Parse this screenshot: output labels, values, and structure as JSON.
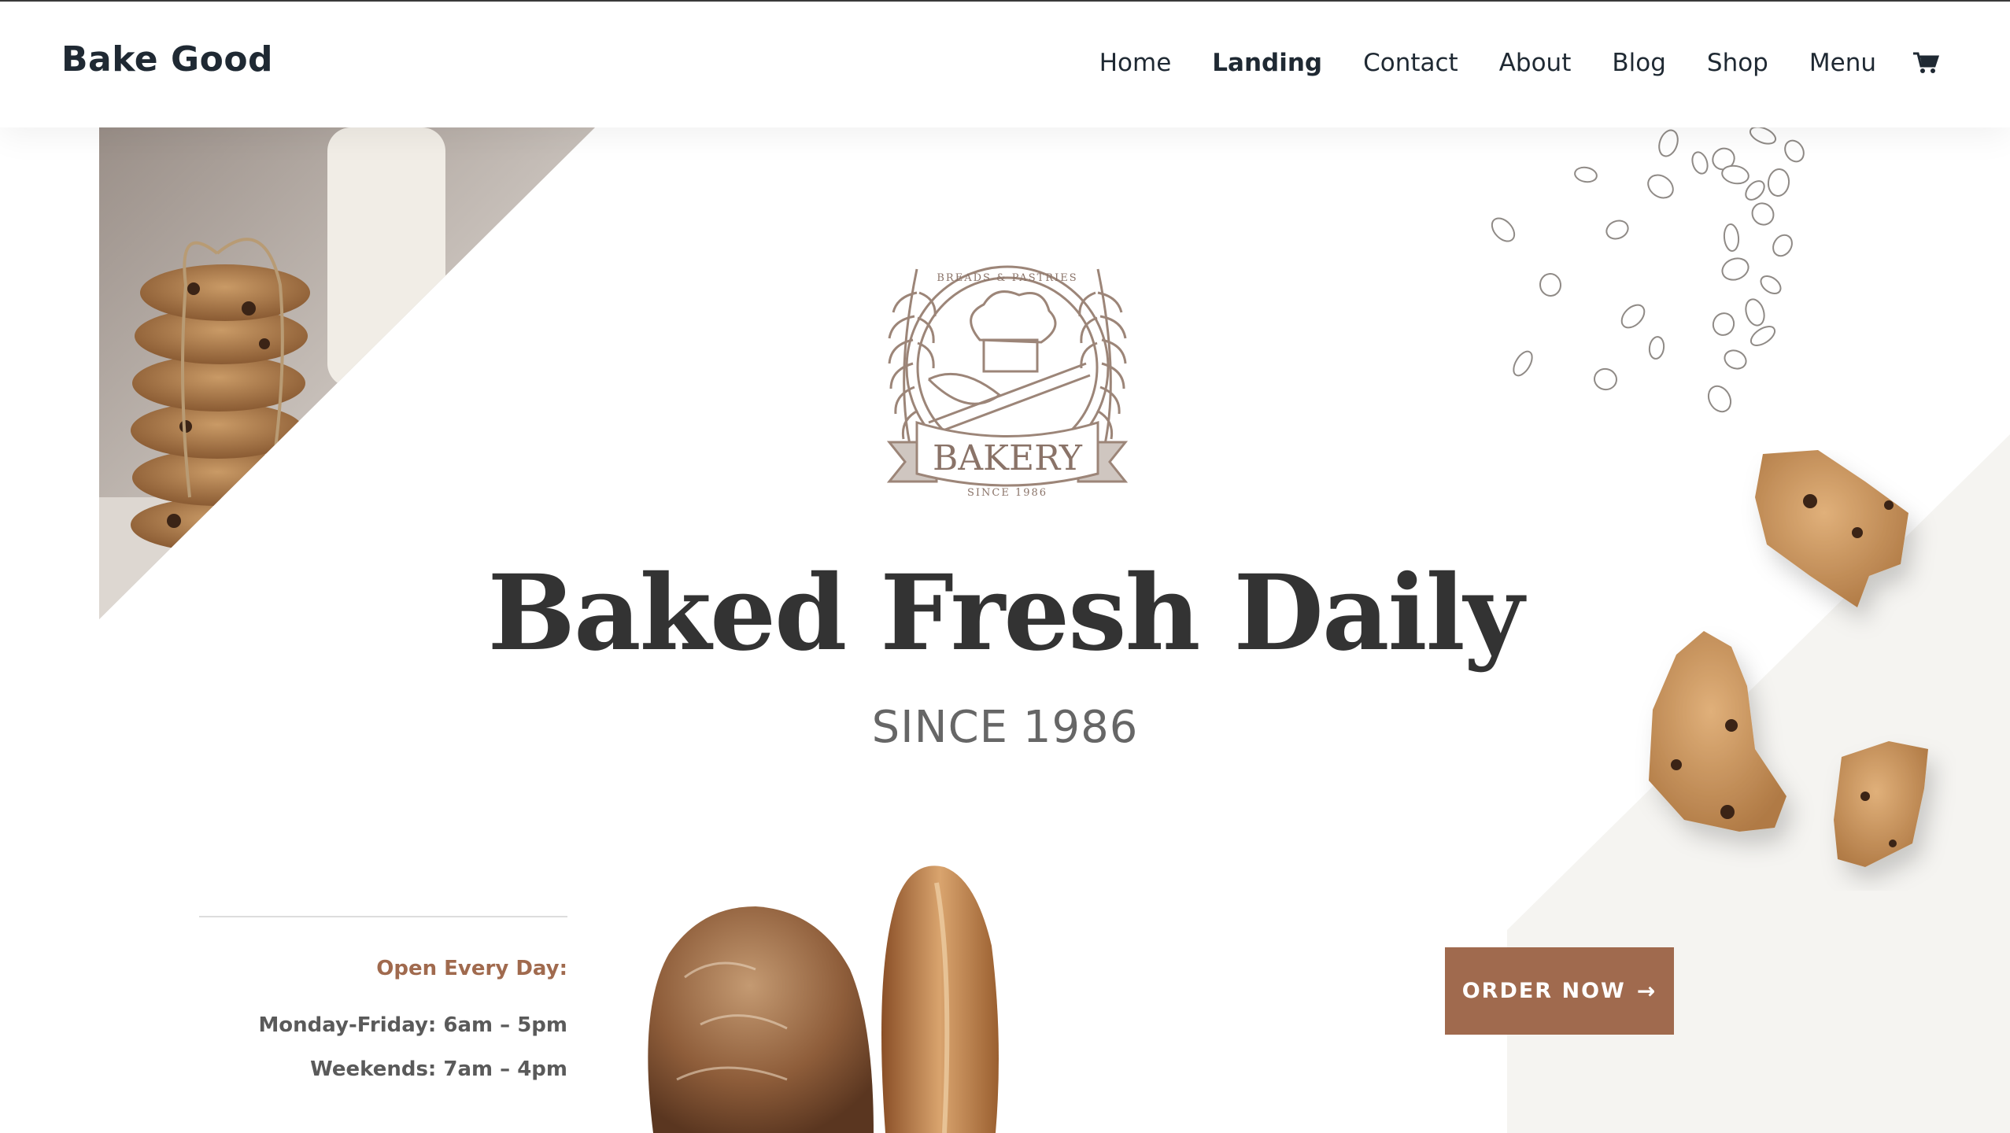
{
  "header": {
    "logo": "Bake Good",
    "nav": [
      {
        "label": "Home",
        "active": false
      },
      {
        "label": "Landing",
        "active": true
      },
      {
        "label": "Contact",
        "active": false
      },
      {
        "label": "About",
        "active": false
      },
      {
        "label": "Blog",
        "active": false
      },
      {
        "label": "Shop",
        "active": false
      },
      {
        "label": "Menu",
        "active": false
      }
    ],
    "cart_icon": "cart-icon"
  },
  "hero": {
    "emblem": {
      "top_text": "BREADS & PASTRIES",
      "banner_text": "BAKERY",
      "bottom_text": "SINCE 1986"
    },
    "headline": "Baked Fresh Daily",
    "subline": "SINCE 1986",
    "hours": {
      "title": "Open Every Day:",
      "weekdays": "Monday-Friday: 6am – 5pm",
      "weekends": "Weekends: 7am – 4pm"
    },
    "cta": {
      "label": "ORDER NOW",
      "arrow": "→"
    }
  },
  "colors": {
    "accent": "#a06a4e",
    "heading": "#333333",
    "text": "#5a5a5a",
    "panel": "#f5f4f1"
  }
}
